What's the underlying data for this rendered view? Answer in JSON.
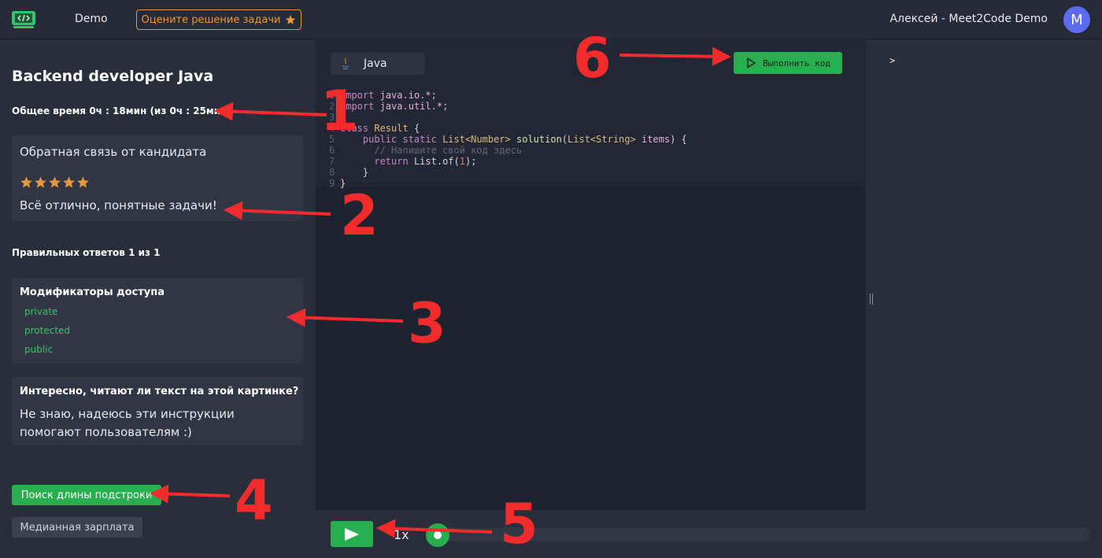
{
  "header": {
    "brand": "Demo",
    "rate_button": "Оцените решение задачи",
    "user_name": "Алексей - Meet2Code Demo",
    "avatar_letter": "M"
  },
  "sidebar": {
    "title": "Backend developer Java",
    "total_time": "Общее время 0ч : 18мин (из 0ч : 25мин)",
    "feedback": {
      "title": "Обратная связь от кандидата",
      "rating": 5,
      "rating_max": 5,
      "text": "Всё отлично, понятные задачи!"
    },
    "correct_answers": "Правильных ответов 1 из 1",
    "question1": {
      "title": "Модификаторы доступа",
      "options": [
        "private",
        "protected",
        "public"
      ]
    },
    "question2": {
      "title": "Интересно, читают ли текст на этой картинке?",
      "answer": "Не знаю, надеюсь эти инструкции помогают пользователям :)"
    },
    "task_buttons": [
      "Поиск длины подстроки",
      "Медианная зарплата"
    ]
  },
  "editor": {
    "language": "Java",
    "run_button": "Выполнить код",
    "line_numbers": [
      "1",
      "2",
      "3",
      "4",
      "5",
      "6",
      "7",
      "8",
      "9"
    ],
    "code": {
      "l1_kw": "import",
      "l1_pkg": "java.io.*;",
      "l2_kw": "import",
      "l2_pkg": "java.util.*;",
      "l4_kw": "class",
      "l4_name": "Result",
      "l4_brace": "{",
      "l5_mods": "public static",
      "l5_type": "List<Number>",
      "l5_fn": "solution",
      "l5_param_type": "List<String>",
      "l5_param": "items",
      "l5_end": ") {",
      "l6_comment": "// Напишите свой код здесь",
      "l7_kw": "return",
      "l7_expr": "List.of(",
      "l7_num": "1",
      "l7_end": ");",
      "l8": "}",
      "l9": "}"
    }
  },
  "console": {
    "prompt": ">"
  },
  "player": {
    "speed": "1x",
    "progress": 0.0
  },
  "annotations": [
    "1",
    "2",
    "3",
    "4",
    "5",
    "6"
  ],
  "colors": {
    "accent_green": "#27ae4f",
    "accent_orange": "#e8963a",
    "annotation_red": "#f22c2c",
    "avatar": "#5b6cf0"
  }
}
